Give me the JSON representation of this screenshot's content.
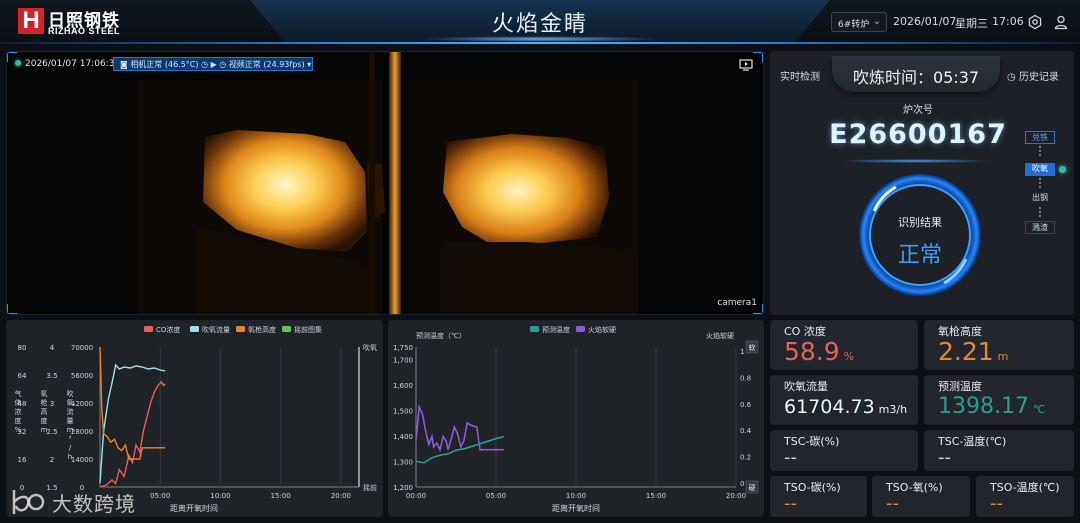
{
  "header": {
    "logo_cn": "日照钢铁",
    "logo_en": "RIZHAO STEEL",
    "title": "火焰金睛",
    "furnace": "6#转炉",
    "date": "2026/01/07",
    "weekday": "星期三",
    "time": "17:06"
  },
  "video": {
    "timestamp": "2026/01/07 17:06:31",
    "camera_status": "相机正常 (46.5°C)",
    "video_status": "视频正常 (24.93fps)",
    "camera_name": "camera1"
  },
  "status": {
    "live_label": "实时检测",
    "timer": "吹炼时间：05:37",
    "history_label": "历史记录",
    "heat_label": "炉次号",
    "heat_number": "E26600167",
    "result_label": "识别结果",
    "result_value": "正常",
    "steps": [
      {
        "label": "兑铁",
        "state": "done"
      },
      {
        "label": "吹氧",
        "state": "active"
      },
      {
        "label": "出钢",
        "state": "pending"
      },
      {
        "label": "溅渣",
        "state": "pending"
      }
    ]
  },
  "chart_left": {
    "type": "line",
    "legend": [
      {
        "name": "CO浓度",
        "color": "#e8605e"
      },
      {
        "name": "吹氧流量",
        "color": "#9fe0ea"
      },
      {
        "name": "氧枪高度",
        "color": "#e8862c"
      },
      {
        "name": "摇前图集",
        "color": "#6cc24a"
      }
    ],
    "axis1": {
      "label": "气体浓度%",
      "ticks": [
        "80",
        "64",
        "48",
        "32",
        "16",
        "0"
      ]
    },
    "axis2": {
      "label": "氧枪高度m",
      "ticks": [
        "4",
        "3.5",
        "3",
        "2.5",
        "2",
        "1.5"
      ]
    },
    "axis3": {
      "label": "吹氧流量m³/h",
      "ticks": [
        "70000",
        "56000",
        "42000",
        "28000",
        "14000",
        "0"
      ]
    },
    "xticks": [
      "05:00",
      "10:00",
      "15:00",
      "20:00"
    ],
    "xlabel": "距离开氧时间",
    "right_top_label": "吹氧",
    "right_bottom_label": "摇前",
    "chart_data": {
      "x_unit": "minutes since oxygen start",
      "series": [
        {
          "name": "CO浓度",
          "axis": "percent",
          "points": [
            [
              0,
              0
            ],
            [
              0.5,
              1
            ],
            [
              1,
              4
            ],
            [
              1.3,
              2
            ],
            [
              1.6,
              10
            ],
            [
              2,
              6
            ],
            [
              2.4,
              18
            ],
            [
              2.7,
              14
            ],
            [
              3,
              24
            ],
            [
              3.3,
              20
            ],
            [
              3.6,
              32
            ],
            [
              3.9,
              40
            ],
            [
              4.2,
              48
            ],
            [
              4.5,
              54
            ],
            [
              4.8,
              58
            ],
            [
              5.1,
              60
            ],
            [
              5.3,
              58
            ],
            [
              5.4,
              59
            ]
          ]
        },
        {
          "name": "吹氧流量",
          "axis": "flow",
          "points": [
            [
              0,
              2000
            ],
            [
              0.3,
              28000
            ],
            [
              0.7,
              44000
            ],
            [
              1,
              52000
            ],
            [
              1.3,
              61000
            ],
            [
              1.6,
              59000
            ],
            [
              2,
              60000
            ],
            [
              2.5,
              59500
            ],
            [
              3,
              60500
            ],
            [
              3.5,
              60000
            ],
            [
              4,
              59000
            ],
            [
              4.5,
              59500
            ],
            [
              5,
              58500
            ],
            [
              5.4,
              58000
            ]
          ]
        },
        {
          "name": "氧枪高度",
          "axis": "lance",
          "points": [
            [
              0,
              4
            ],
            [
              0.15,
              2.9
            ],
            [
              0.3,
              2.45
            ],
            [
              0.6,
              2.4
            ],
            [
              0.9,
              2.3
            ],
            [
              1.2,
              2.35
            ],
            [
              1.5,
              2.2
            ],
            [
              1.8,
              2.15
            ],
            [
              2.1,
              2.25
            ],
            [
              2.4,
              2.0
            ],
            [
              3,
              2.0
            ],
            [
              3.3,
              2.0
            ],
            [
              3.5,
              2.2
            ],
            [
              4,
              2.2
            ],
            [
              4.5,
              2.2
            ],
            [
              5,
              2.2
            ],
            [
              5.4,
              2.2
            ]
          ]
        }
      ]
    }
  },
  "chart_right": {
    "type": "line",
    "legend": [
      {
        "name": "预测温度",
        "color": "#2a9d8f"
      },
      {
        "name": "火焰软硬",
        "color": "#8a5cd6"
      }
    ],
    "ylabel_left": "预测温度（℃）",
    "ylabel_right": "火焰软硬",
    "yticks_left": [
      "1,750",
      "1,700",
      "1,600",
      "1,500",
      "1,400",
      "1,300",
      "1,200"
    ],
    "yticks_right": [
      "1",
      "0.8",
      "0.6",
      "0.4",
      "0.2",
      "0"
    ],
    "right_top_label": "软",
    "right_bottom_label": "硬",
    "xticks": [
      "00:00",
      "05:00",
      "10:00",
      "15:00",
      "20:00"
    ],
    "xlabel": "距离开氧时间",
    "chart_data": {
      "x_unit": "minutes since oxygen start",
      "series": [
        {
          "name": "预测温度",
          "axis": "temp",
          "points": [
            [
              0,
              1300
            ],
            [
              0.5,
              1295
            ],
            [
              1,
              1315
            ],
            [
              1.5,
              1325
            ],
            [
              2,
              1330
            ],
            [
              2.5,
              1345
            ],
            [
              3,
              1350
            ],
            [
              3.5,
              1360
            ],
            [
              4,
              1370
            ],
            [
              4.5,
              1380
            ],
            [
              5,
              1390
            ],
            [
              5.5,
              1398
            ]
          ]
        },
        {
          "name": "火焰软硬",
          "axis": "hardness",
          "points": [
            [
              0,
              0.35
            ],
            [
              0.2,
              0.6
            ],
            [
              0.4,
              0.55
            ],
            [
              0.6,
              0.42
            ],
            [
              0.8,
              0.32
            ],
            [
              1,
              0.38
            ],
            [
              1.1,
              0.3
            ],
            [
              1.3,
              0.33
            ],
            [
              1.5,
              0.28
            ],
            [
              1.7,
              0.38
            ],
            [
              1.9,
              0.34
            ],
            [
              2,
              0.28
            ],
            [
              2.2,
              0.36
            ],
            [
              2.4,
              0.45
            ],
            [
              2.6,
              0.4
            ],
            [
              2.8,
              0.3
            ],
            [
              3,
              0.35
            ],
            [
              3.2,
              0.48
            ],
            [
              3.5,
              0.46
            ],
            [
              3.8,
              0.45
            ],
            [
              4,
              0.28
            ],
            [
              4.5,
              0.28
            ],
            [
              5,
              0.28
            ],
            [
              5.5,
              0.28
            ]
          ]
        }
      ]
    }
  },
  "metrics": {
    "co": {
      "label": "CO 浓度",
      "value": "58.9",
      "unit": "%",
      "color": "#e8605e"
    },
    "lance": {
      "label": "氧枪高度",
      "value": "2.21",
      "unit": "m",
      "color": "#e8862c"
    },
    "flow": {
      "label": "吹氧流量",
      "value": "61704.73",
      "unit": "m3/h",
      "color": "#e8f6ff"
    },
    "temp": {
      "label": "预测温度",
      "value": "1398.17",
      "unit": "℃",
      "color": "#2a9d8f"
    },
    "tsc_c": {
      "label": "TSC-碳(%)",
      "value": "--",
      "color": "#cfd6de"
    },
    "tsc_t": {
      "label": "TSC-温度(℃)",
      "value": "--",
      "color": "#cfd6de"
    },
    "tso_c": {
      "label": "TSO-碳(%)",
      "value": "--",
      "color": "#e8862c"
    },
    "tso_o": {
      "label": "TSO-氧(%)",
      "value": "--",
      "color": "#e8862c"
    },
    "tso_t": {
      "label": "TSO-温度(℃)",
      "value": "--",
      "color": "#e8862c"
    }
  },
  "watermark": "大数跨境"
}
